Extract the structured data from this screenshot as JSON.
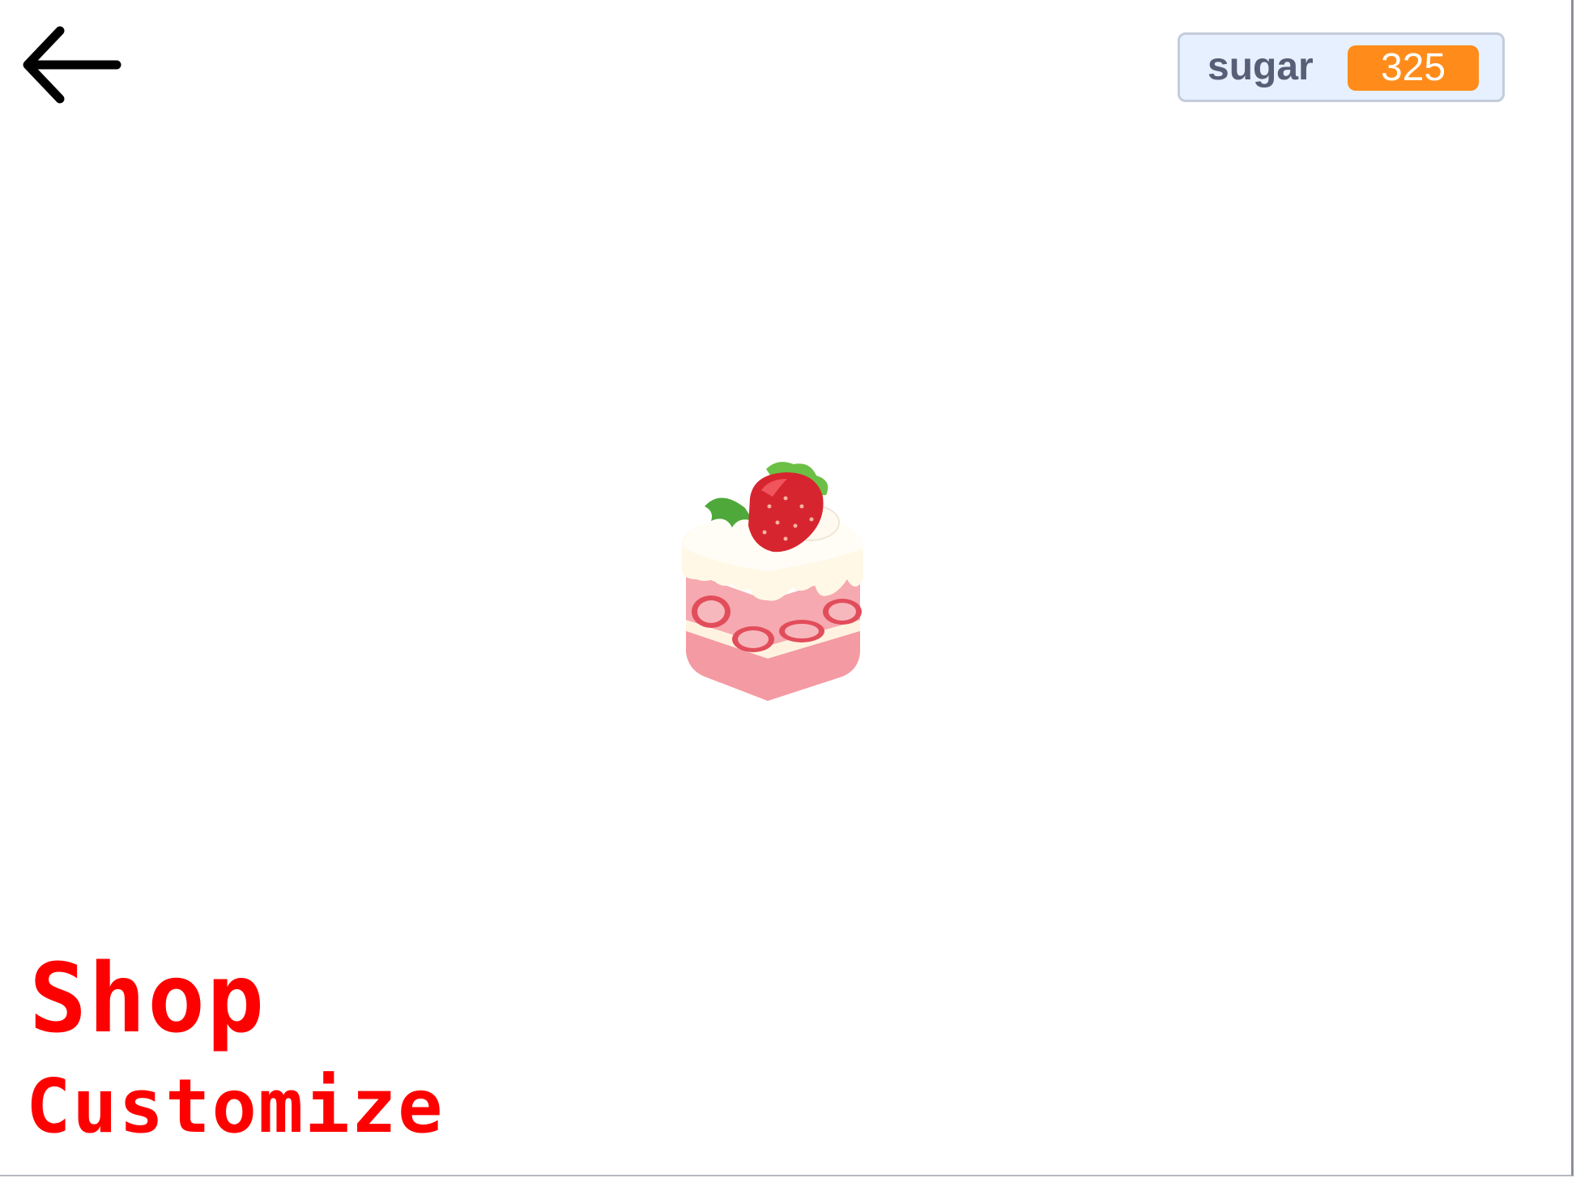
{
  "back_button": {
    "icon": "arrow-left-icon"
  },
  "variable_monitor": {
    "label": "sugar",
    "value": "325",
    "value_color": "#ff8c1a"
  },
  "sprite": {
    "icon": "strawberry-cake-icon"
  },
  "menu": {
    "shop_label": "Shop",
    "customize_label": "Customize",
    "label_color": "#ff0000"
  }
}
